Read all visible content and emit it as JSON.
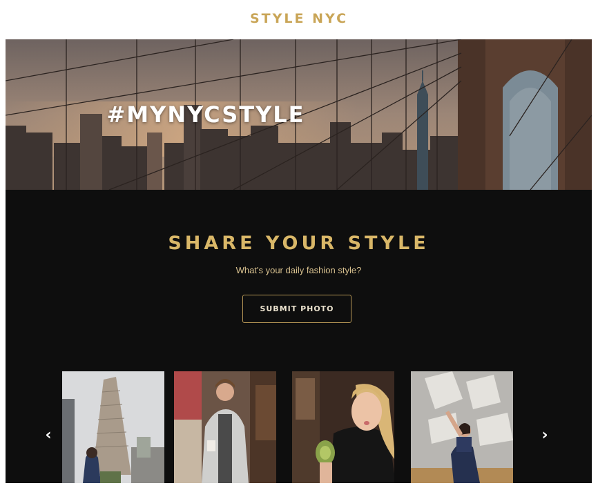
{
  "header": {
    "brand": "STYLE NYC"
  },
  "hero": {
    "title": "#MYNYCSTYLE",
    "image": "brooklyn-bridge-skyline"
  },
  "share": {
    "title": "SHARE YOUR STYLE",
    "subtitle": "What's your daily fashion style?",
    "button_label": "SUBMIT PHOTO"
  },
  "carousel": {
    "prev_icon": "chevron-left-icon",
    "next_icon": "chevron-right-icon",
    "prev_glyph": "‹",
    "next_glyph": "›",
    "photos": [
      {
        "image": "flatiron-building-woman"
      },
      {
        "image": "man-in-grey-coat"
      },
      {
        "image": "woman-eating-avocado-toast"
      },
      {
        "image": "woman-posing-sunlit-wall"
      }
    ]
  },
  "colors": {
    "gold": "#c9a557",
    "dark_background": "#0e0e0e",
    "hero_text": "#ffffff"
  }
}
